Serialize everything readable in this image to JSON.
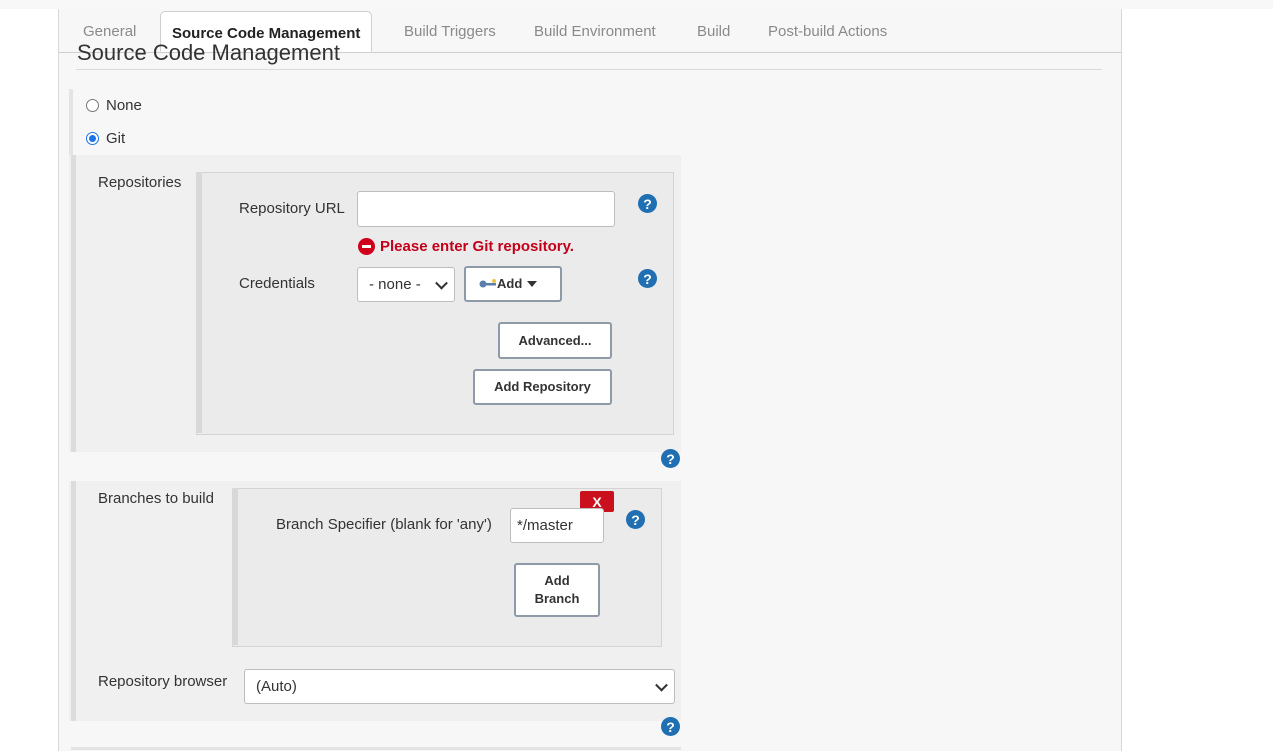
{
  "tabs": [
    {
      "label": "General"
    },
    {
      "label": "Source Code Management"
    },
    {
      "label": "Build Triggers"
    },
    {
      "label": "Build Environment"
    },
    {
      "label": "Build"
    },
    {
      "label": "Post-build Actions"
    }
  ],
  "section": {
    "title": "Source Code Management"
  },
  "scm_options": [
    {
      "label": "None",
      "checked": false
    },
    {
      "label": "Git",
      "checked": true
    }
  ],
  "repositories": {
    "label": "Repositories",
    "url_label": "Repository URL",
    "url_value": "",
    "error": "Please enter Git repository.",
    "credentials_label": "Credentials",
    "credentials_value": "- none -",
    "add_label": "Add",
    "advanced_label": "Advanced...",
    "add_repository_label": "Add Repository"
  },
  "branches": {
    "label": "Branches to build",
    "delete_label": "X",
    "specifier_label": "Branch Specifier (blank for 'any')",
    "specifier_value": "*/master",
    "add_branch_label": "Add Branch"
  },
  "browser": {
    "label": "Repository browser",
    "value": "(Auto)"
  },
  "help_symbol": "?",
  "colors": {
    "help": "#1f6fb2",
    "error": "#c4001a",
    "delete": "#c9101c",
    "radio_selected": "#1a73e8"
  }
}
